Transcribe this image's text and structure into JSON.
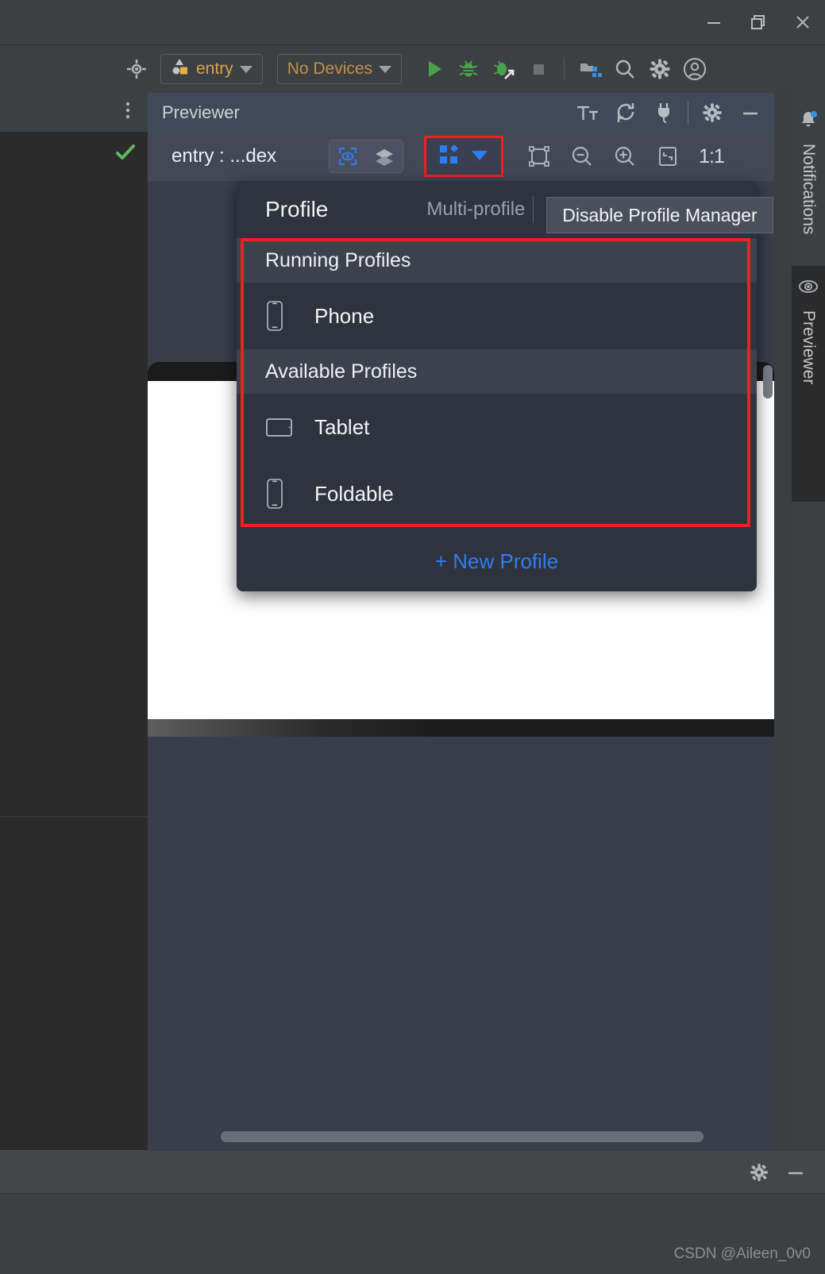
{
  "window": {
    "minimize_label": "minimize",
    "restore_label": "restore",
    "close_label": "close"
  },
  "toolbar": {
    "target_icon": "target-icon",
    "module_selector": "entry",
    "device_selector": "No Devices",
    "run_icon": "run-icon",
    "debug_icon": "debug-icon",
    "attach_debug_icon": "attach-debugger-icon",
    "stop_icon": "stop-icon",
    "project_structure_icon": "project-structure-icon",
    "search_icon": "search-icon",
    "settings_icon": "gear-icon",
    "account_icon": "account-icon"
  },
  "previewer": {
    "title": "Previewer",
    "text_size_icon": "text-size-icon",
    "refresh_icon": "refresh-icon",
    "plug_icon": "plug-icon",
    "settings_icon": "gear-icon",
    "minimize_icon": "minimize-icon",
    "file_label": "entry : ...dex",
    "inspect_icon": "inspect-icon",
    "layers_icon": "layers-icon",
    "profile_icon": "multi-profile-icon",
    "profile_caret_icon": "chevron-down-icon",
    "frame_icon": "frame-icon",
    "zoom_out_icon": "zoom-out-icon",
    "zoom_in_icon": "zoom-in-icon",
    "fit_icon": "fit-to-screen-icon",
    "zoom_ratio": "1:1"
  },
  "popup": {
    "title": "Profile",
    "multi_profile_label": "Multi-profile",
    "disable_button": "Disable Profile Manager",
    "sections": [
      {
        "header": "Running Profiles",
        "items": [
          {
            "label": "Phone",
            "icon": "phone-icon"
          }
        ]
      },
      {
        "header": "Available Profiles",
        "items": [
          {
            "label": "Tablet",
            "icon": "tablet-icon"
          },
          {
            "label": "Foldable",
            "icon": "foldable-icon"
          }
        ]
      }
    ],
    "new_profile": "+ New Profile",
    "highlight_color": "#ee2020",
    "link_color": "#2b7ef5"
  },
  "right_strip": {
    "notifications_label": "Notifications",
    "notifications_icon": "bell-icon",
    "notifications_badge_color": "#3a8fe0",
    "previewer_label": "Previewer",
    "previewer_icon": "eye-icon"
  },
  "left_panel": {
    "more_icon": "more-vertical-icon",
    "status_icon": "check-icon",
    "status_color": "#5fb65f"
  },
  "bottom": {
    "settings_icon": "gear-icon",
    "minimize_icon": "minimize-icon"
  },
  "status": {
    "watermark": "CSDN @Aileen_0v0"
  }
}
